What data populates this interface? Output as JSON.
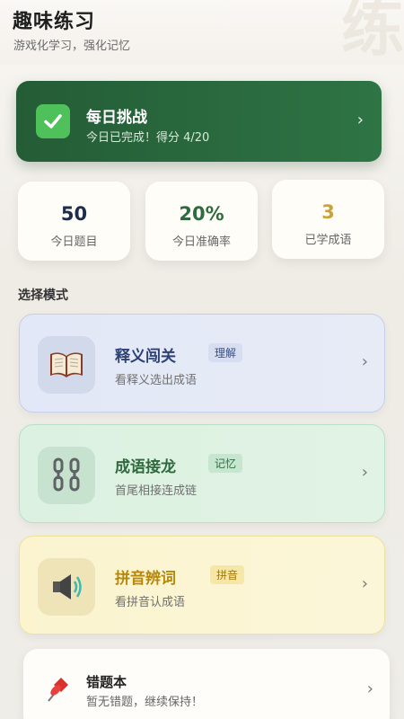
{
  "header": {
    "title": "趣味练习",
    "subtitle": "游戏化学习，强化记忆",
    "watermark": "练"
  },
  "daily_challenge": {
    "title": "每日挑战",
    "status": "今日已完成！得分 4/20",
    "icon": "check-icon",
    "colors": {
      "start": "#245c36",
      "end": "#2e7444",
      "check": "#4ec15a"
    }
  },
  "stats": [
    {
      "value": "50",
      "label": "今日题目",
      "color": "#1f2d4d"
    },
    {
      "value": "20%",
      "label": "今日准确率",
      "color": "#2f6b3e"
    },
    {
      "value": "3",
      "label": "已学成语",
      "color": "#c9a33a"
    }
  ],
  "section_label": "选择模式",
  "modes": [
    {
      "title": "释义闯关",
      "tag": "理解",
      "desc": "看释义选出成语",
      "icon": "book-icon"
    },
    {
      "title": "成语接龙",
      "tag": "记忆",
      "desc": "首尾相接连成链",
      "icon": "chain-icon"
    },
    {
      "title": "拼音辨词",
      "tag": "拼音",
      "desc": "看拼音认成语",
      "icon": "speaker-icon"
    }
  ],
  "mistakes": {
    "title": "错题本",
    "desc": "暂无错题，继续保持！",
    "icon": "pushpin-icon"
  }
}
